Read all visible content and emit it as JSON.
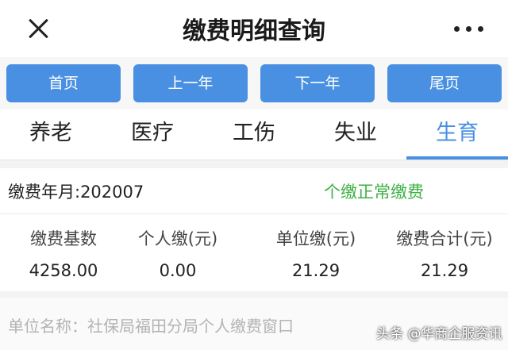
{
  "header": {
    "title": "缴费明细查询",
    "close_icon": "close-icon",
    "more_icon": "more-icon"
  },
  "nav": {
    "first": "首页",
    "prev_year": "上一年",
    "next_year": "下一年",
    "last": "尾页",
    "accent": "#4a90e2"
  },
  "tabs": [
    {
      "label": "养老"
    },
    {
      "label": "医疗"
    },
    {
      "label": "工伤"
    },
    {
      "label": "失业"
    },
    {
      "label": "生育",
      "active": true
    }
  ],
  "record": {
    "period": "缴费年月:202007",
    "status": "个缴正常缴费",
    "status_color": "#3cb043",
    "columns": [
      "缴费基数",
      "个人缴(元)",
      "单位缴(元)",
      "缴费合计(元)"
    ],
    "values": [
      "4258.00",
      "0.00",
      "21.29",
      "21.29"
    ],
    "unit_name": "单位名称：社保局福田分局个人缴费窗口"
  },
  "watermark": "头条 @华商企服资讯"
}
